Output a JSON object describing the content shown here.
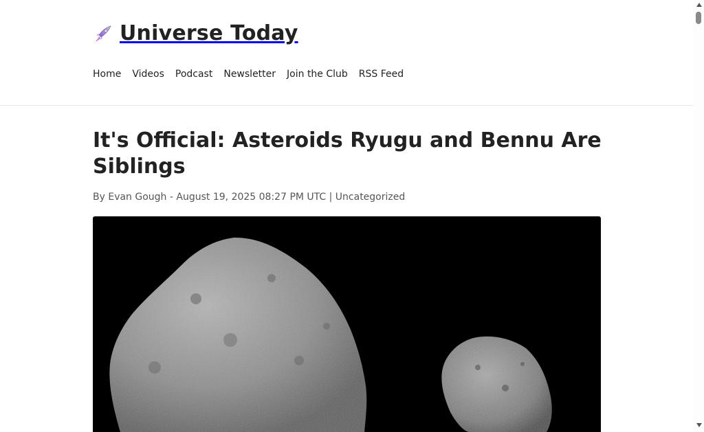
{
  "site": {
    "title": "Universe Today",
    "logo_icon": "rocket-icon"
  },
  "nav": {
    "items": [
      {
        "label": "Home"
      },
      {
        "label": "Videos"
      },
      {
        "label": "Podcast"
      },
      {
        "label": "Newsletter"
      },
      {
        "label": "Join the Club"
      },
      {
        "label": "RSS Feed"
      }
    ]
  },
  "article": {
    "title": "It's Official: Asteroids Ryugu and Bennu Are Siblings",
    "byline_prefix": "By",
    "author": "Evan Gough",
    "separator": "-",
    "date": "August 19, 2025 08:27 PM UTC",
    "divider": "|",
    "category": "Uncategorized"
  },
  "colors": {
    "background": "#ffffff",
    "text": "#222222",
    "meta_text": "#555555",
    "hero_background": "#000000"
  }
}
